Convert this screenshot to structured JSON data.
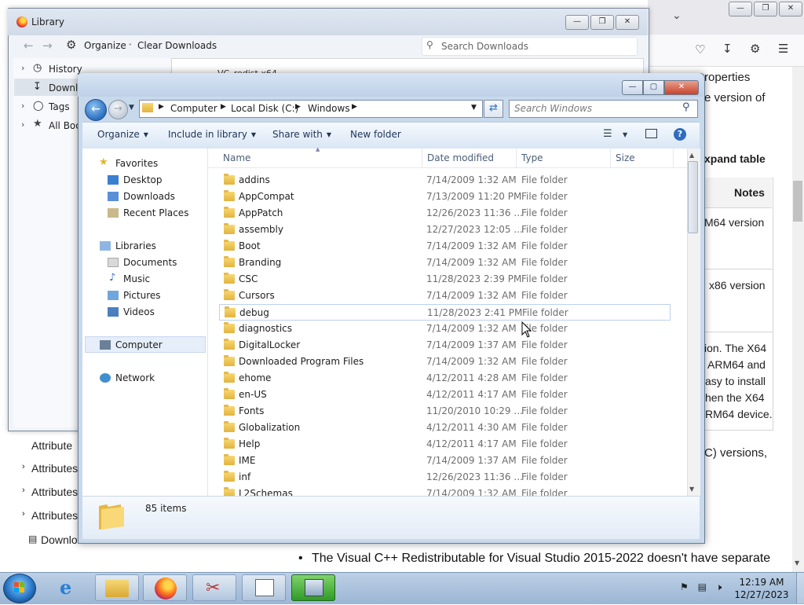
{
  "firefox": {
    "toolbar_icons": [
      "pocket-icon",
      "download-icon",
      "extensions-icon",
      "menu-icon"
    ],
    "content_lines": [
      "roperties",
      "e version of",
      "xpand table"
    ],
    "table_header": "Notes",
    "table_cells": [
      "M64 version",
      "x86 version"
    ],
    "paragraph_lines": [
      "ion. The X64",
      "ARM64 and",
      "asy to install",
      "hen the X64",
      "RM64 device."
    ],
    "after_table": "C) versions,",
    "bullet_text": "The Visual C++ Redistributable for Visual Studio 2015-2022 doesn't have separate",
    "left_lower": {
      "attribute_plain": "Attribute",
      "attribute_items": [
        "Attributes",
        "Attributes",
        "Attributes"
      ],
      "downloads_label": "Downlo"
    }
  },
  "library": {
    "title": "Library",
    "organize": "Organize",
    "clear_downloads": "Clear Downloads",
    "search_placeholder": "Search Downloads",
    "tree": [
      "History",
      "Downlo",
      "Tags",
      "All Boo"
    ],
    "right_partial": "VC_redist.x64"
  },
  "explorer": {
    "breadcrumb": [
      "Computer",
      "Local Disk (C:)",
      "Windows"
    ],
    "search_placeholder": "Search Windows",
    "commands": {
      "organize": "Organize",
      "include": "Include in library",
      "share": "Share with",
      "new_folder": "New folder"
    },
    "nav": {
      "favorites": "Favorites",
      "favorite_items": [
        "Desktop",
        "Downloads",
        "Recent Places"
      ],
      "libraries": "Libraries",
      "library_items": [
        "Documents",
        "Music",
        "Pictures",
        "Videos"
      ],
      "computer": "Computer",
      "network": "Network"
    },
    "columns": {
      "name": "Name",
      "date": "Date modified",
      "type": "Type",
      "size": "Size"
    },
    "files": [
      {
        "name": "addins",
        "date": "7/14/2009 1:32 AM",
        "type": "File folder"
      },
      {
        "name": "AppCompat",
        "date": "7/13/2009 11:20 PM",
        "type": "File folder"
      },
      {
        "name": "AppPatch",
        "date": "12/26/2023 11:36 ...",
        "type": "File folder"
      },
      {
        "name": "assembly",
        "date": "12/27/2023 12:05 ...",
        "type": "File folder"
      },
      {
        "name": "Boot",
        "date": "7/14/2009 1:32 AM",
        "type": "File folder"
      },
      {
        "name": "Branding",
        "date": "7/14/2009 1:32 AM",
        "type": "File folder"
      },
      {
        "name": "CSC",
        "date": "11/28/2023 2:39 PM",
        "type": "File folder"
      },
      {
        "name": "Cursors",
        "date": "7/14/2009 1:32 AM",
        "type": "File folder"
      },
      {
        "name": "debug",
        "date": "11/28/2023 2:41 PM",
        "type": "File folder"
      },
      {
        "name": "diagnostics",
        "date": "7/14/2009 1:32 AM",
        "type": "File folder"
      },
      {
        "name": "DigitalLocker",
        "date": "7/14/2009 1:37 AM",
        "type": "File folder"
      },
      {
        "name": "Downloaded Program Files",
        "date": "7/14/2009 1:32 AM",
        "type": "File folder"
      },
      {
        "name": "ehome",
        "date": "4/12/2011 4:28 AM",
        "type": "File folder"
      },
      {
        "name": "en-US",
        "date": "4/12/2011 4:17 AM",
        "type": "File folder"
      },
      {
        "name": "Fonts",
        "date": "11/20/2010 10:29 ...",
        "type": "File folder"
      },
      {
        "name": "Globalization",
        "date": "4/12/2011 4:30 AM",
        "type": "File folder"
      },
      {
        "name": "Help",
        "date": "4/12/2011 4:17 AM",
        "type": "File folder"
      },
      {
        "name": "IME",
        "date": "7/14/2009 1:37 AM",
        "type": "File folder"
      },
      {
        "name": "inf",
        "date": "12/26/2023 11:36 ...",
        "type": "File folder"
      },
      {
        "name": "L2Schemas",
        "date": "7/14/2009 1:32 AM",
        "type": "File folder"
      }
    ],
    "status_count": "85 items"
  },
  "taskbar": {
    "time": "12:19 AM",
    "date": "12/27/2023"
  },
  "colors": {
    "accent": "#2a6fbf",
    "selection_border": "#bdd1ec",
    "taskbar": "#9bb6d4"
  }
}
